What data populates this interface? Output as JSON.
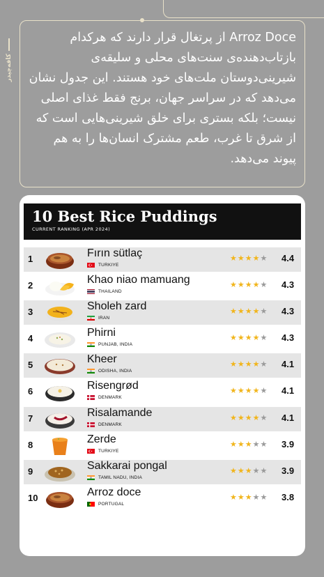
{
  "side_brand": {
    "text": "کافه‌چیدر"
  },
  "description": {
    "text": "Arroz Doce از پرتغال قرار دارند که هرکدام بازتاب‌دهنده‌ی سنت‌های محلی و سلیقه‌ی شیرینی‌دوستان ملت‌های خود هستند. این جدول نشان می‌دهد که در سراسر جهان، برنج فقط غذای اصلی نیست؛ بلکه بستری برای خلق شیرینی‌هایی است که از شرق تا غرب، طعم مشترک انسان‌ها را به هم پیوند می‌دهد."
  },
  "ranking": {
    "title": "10 Best Rice Puddings",
    "subtitle": "CURRENT RANKING (APR 2024)",
    "items": [
      {
        "rank": "1",
        "name": "Fırın sütlaç",
        "location": "TURKIYE",
        "flag": "turkey",
        "rating": "4.4",
        "stars": 4.4,
        "dish": "baked-bowl"
      },
      {
        "rank": "2",
        "name": "Khao niao mamuang",
        "location": "THAILAND",
        "flag": "thailand",
        "rating": "4.3",
        "stars": 4.3,
        "dish": "mango-rice"
      },
      {
        "rank": "3",
        "name": "Sholeh zard",
        "location": "IRAN",
        "flag": "iran",
        "rating": "4.3",
        "stars": 4.3,
        "dish": "saffron-bowl"
      },
      {
        "rank": "4",
        "name": "Phirni",
        "location": "PUNJAB, INDIA",
        "flag": "india",
        "rating": "4.3",
        "stars": 4.3,
        "dish": "white-plate"
      },
      {
        "rank": "5",
        "name": "Kheer",
        "location": "ODISHA, INDIA",
        "flag": "india",
        "rating": "4.1",
        "stars": 4.1,
        "dish": "kheer-bowl"
      },
      {
        "rank": "6",
        "name": "Risengrød",
        "location": "DENMARK",
        "flag": "denmark",
        "rating": "4.1",
        "stars": 4.1,
        "dish": "dark-bowl"
      },
      {
        "rank": "7",
        "name": "Risalamande",
        "location": "DENMARK",
        "flag": "denmark",
        "rating": "4.1",
        "stars": 4.1,
        "dish": "cherry-bowl"
      },
      {
        "rank": "8",
        "name": "Zerde",
        "location": "TURKIYE",
        "flag": "turkey",
        "rating": "3.9",
        "stars": 3.9,
        "dish": "orange-cup"
      },
      {
        "rank": "9",
        "name": "Sakkarai pongal",
        "location": "TAMIL NADU, INDIA",
        "flag": "india",
        "rating": "3.9",
        "stars": 3.9,
        "dish": "pongal-plate"
      },
      {
        "rank": "10",
        "name": "Arroz doce",
        "location": "PORTUGAL",
        "flag": "portugal",
        "rating": "3.8",
        "stars": 3.8,
        "dish": "baked-bowl"
      }
    ]
  },
  "colors": {
    "background": "#9d9d9d",
    "frame": "#e9e1c9",
    "star": "#f1b51c",
    "star_empty": "#9a9a9a",
    "header": "#111111"
  }
}
